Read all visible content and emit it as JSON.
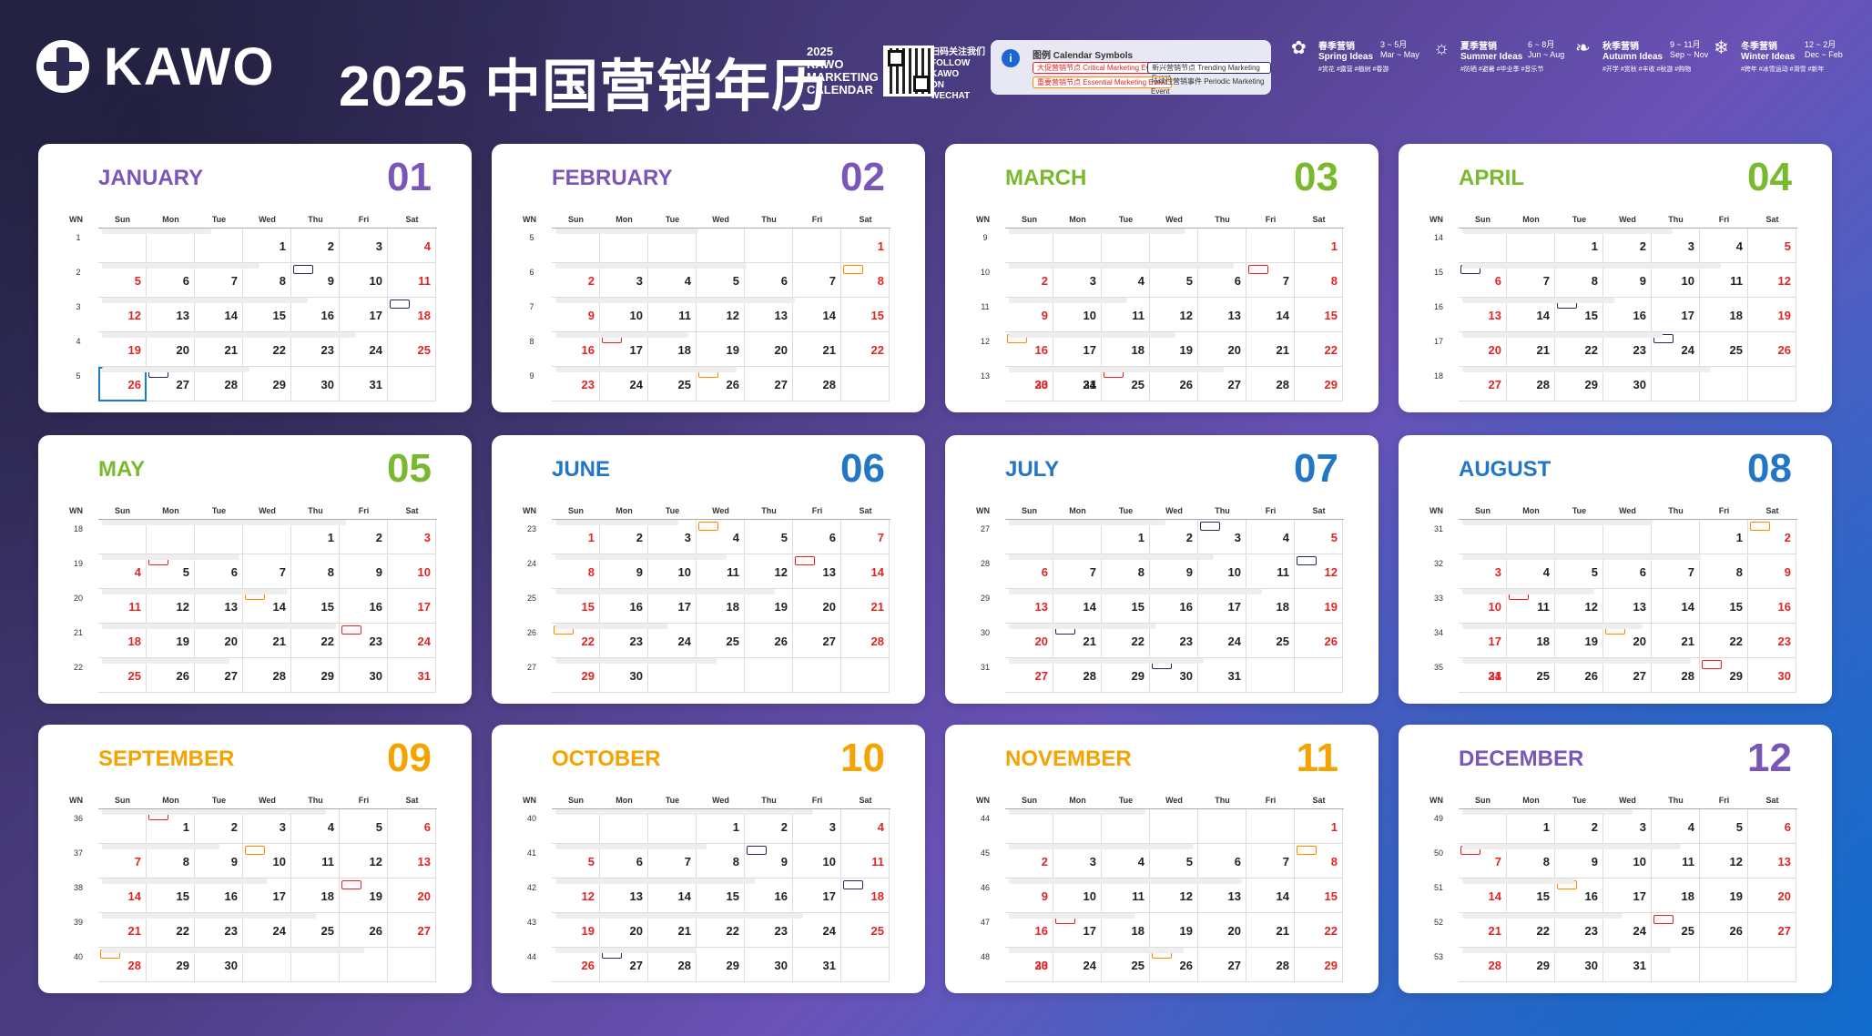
{
  "header": {
    "brand": "KAWO",
    "title": "2025 中国营销年历",
    "subtitle": [
      "2025",
      "KAWO",
      "MARKETING",
      "CALENDAR"
    ],
    "follow": [
      "扫码关注我们",
      "FOLLOW",
      "KAWO",
      "ON",
      "WECHAT"
    ],
    "legend": {
      "title": "图例 Calendar Symbols",
      "items": [
        {
          "label": "大促营销节点 Critical Marketing Event"
        },
        {
          "label": "新兴营销节点 Trending Marketing Event"
        },
        {
          "label": "重要营销节点 Essential Marketing Event"
        },
        {
          "label": "持续性营销事件 Periodic Marketing Event"
        }
      ]
    },
    "seasons": [
      {
        "name": "春季营销",
        "en": "Spring Ideas",
        "months": "3 ~ 5月",
        "range": "Mar ~ May",
        "tags": "#赏花 #露营 #植树 #春游"
      },
      {
        "name": "夏季营销",
        "en": "Summer Ideas",
        "months": "6 ~ 8月",
        "range": "Jun ~ Aug",
        "tags": "#防晒 #避暑 #毕业季 #音乐节"
      },
      {
        "name": "秋季营销",
        "en": "Autumn Ideas",
        "months": "9 ~ 11月",
        "range": "Sep ~ Nov",
        "tags": "#开学 #赏秋 #丰收 #秋游 #购物"
      },
      {
        "name": "冬季营销",
        "en": "Winter Ideas",
        "months": "12 ~ 2月",
        "range": "Dec ~ Feb",
        "tags": "#跨年 #冰雪运动 #滑雪 #新年"
      }
    ]
  },
  "months": [
    {
      "name": "JANUARY",
      "num": "01",
      "color": "#7a56b8",
      "start": 3,
      "days": 31,
      "weeks": [
        "1",
        "2",
        "3",
        "4",
        "5"
      ]
    },
    {
      "name": "FEBRUARY",
      "num": "02",
      "color": "#7a56b8",
      "start": 6,
      "days": 28,
      "weeks": [
        "5",
        "6",
        "7",
        "8",
        "9"
      ]
    },
    {
      "name": "MARCH",
      "num": "03",
      "color": "#79b92d",
      "start": 6,
      "days": 31,
      "weeks": [
        "9",
        "10",
        "11",
        "12",
        "13"
      ]
    },
    {
      "name": "APRIL",
      "num": "04",
      "color": "#79b92d",
      "start": 2,
      "days": 30,
      "weeks": [
        "14",
        "15",
        "16",
        "17",
        "18"
      ]
    },
    {
      "name": "MAY",
      "num": "05",
      "color": "#79b92d",
      "start": 4,
      "days": 31,
      "weeks": [
        "18",
        "19",
        "20",
        "21",
        "22"
      ]
    },
    {
      "name": "JUNE",
      "num": "06",
      "color": "#2176c5",
      "start": 0,
      "days": 30,
      "weeks": [
        "23",
        "24",
        "25",
        "26",
        "27"
      ]
    },
    {
      "name": "JULY",
      "num": "07",
      "color": "#2176c5",
      "start": 2,
      "days": 31,
      "weeks": [
        "27",
        "28",
        "29",
        "30",
        "31"
      ]
    },
    {
      "name": "AUGUST",
      "num": "08",
      "color": "#2176c5",
      "start": 5,
      "days": 31,
      "weeks": [
        "31",
        "32",
        "33",
        "34",
        "35"
      ]
    },
    {
      "name": "SEPTEMBER",
      "num": "09",
      "color": "#f4a300",
      "start": 1,
      "days": 30,
      "weeks": [
        "36",
        "37",
        "38",
        "39",
        "40"
      ]
    },
    {
      "name": "OCTOBER",
      "num": "10",
      "color": "#f4a300",
      "start": 3,
      "days": 31,
      "weeks": [
        "40",
        "41",
        "42",
        "43",
        "44"
      ]
    },
    {
      "name": "NOVEMBER",
      "num": "11",
      "color": "#f4a300",
      "start": 6,
      "days": 30,
      "weeks": [
        "44",
        "45",
        "46",
        "47",
        "48"
      ]
    },
    {
      "name": "DECEMBER",
      "num": "12",
      "color": "#7a56b8",
      "start": 1,
      "days": 31,
      "weeks": [
        "49",
        "50",
        "51",
        "52",
        "53"
      ]
    }
  ],
  "dows": [
    "Sun",
    "Mon",
    "Tue",
    "Wed",
    "Thu",
    "Fri",
    "Sat"
  ],
  "wn_label": "WN",
  "colors": {
    "weekday_red": "#e12424",
    "grid": "#dddddd"
  },
  "icons": {
    "info": "info-icon",
    "spring": "flower-icon",
    "summer": "sun-icon",
    "autumn": "leaf-icon",
    "winter": "snowflake-icon"
  }
}
